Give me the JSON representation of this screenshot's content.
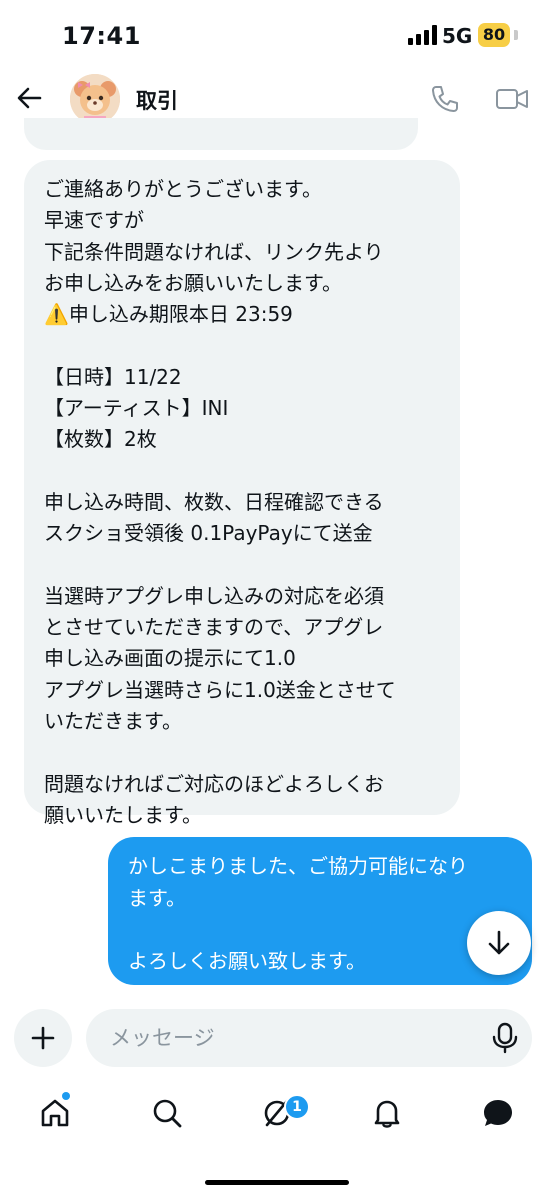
{
  "status_bar": {
    "time": "17:41",
    "network": "5G",
    "battery": "80"
  },
  "header": {
    "title": "取引"
  },
  "messages": {
    "received": [
      "ご連絡ありがとうございます。",
      "早速ですが",
      "下記条件問題なければ、リンク先より",
      "お申し込みをお願いいたします。",
      "⚠️申し込み期限本日 23:59",
      "",
      "【日時】11/22",
      "【アーティスト】INI",
      "【枚数】2枚",
      "",
      "申し込み時間、枚数、日程確認できる",
      "スクショ受領後 0.1PayPayにて送金",
      "",
      "当選時アプグレ申し込みの対応を必須",
      "とさせていただきますので、アプグレ",
      "申し込み画面の提示にて1.0",
      "アプグレ当選時さらに1.0送金とさせて",
      "いただきます。",
      "",
      "問題なければご対応のほどよろしくお",
      "願いいたします。"
    ],
    "sent": [
      "かしこまりました、ご協力可能になり",
      "ます。",
      "",
      "よろしくお願い致します。"
    ]
  },
  "composer": {
    "placeholder": "メッセージ"
  },
  "nav": {
    "messages_badge": "1"
  },
  "colors": {
    "accent": "#1d9bf0",
    "bubble_in": "#eff3f4",
    "battery": "#f7ce46"
  },
  "icons": [
    "back-arrow-icon",
    "phone-icon",
    "video-icon",
    "arrow-down-icon",
    "plus-icon",
    "mic-icon",
    "home-icon",
    "search-icon",
    "grok-icon",
    "bell-icon",
    "messages-icon"
  ]
}
